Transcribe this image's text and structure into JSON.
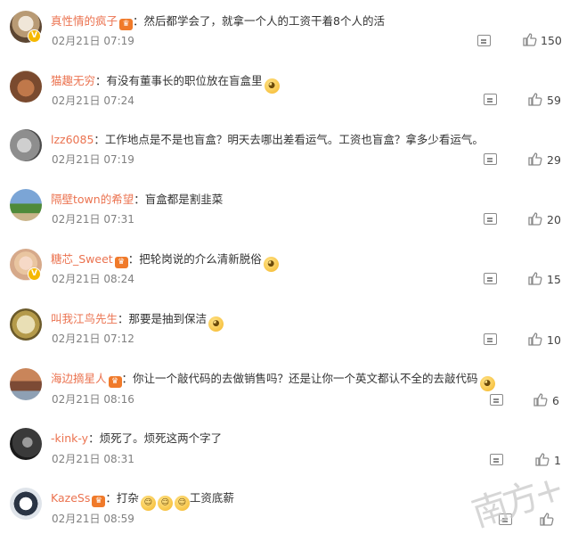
{
  "comments": [
    {
      "user": "真性情的疯子",
      "has_crown": true,
      "verified": true,
      "text": "：然后都学会了，就拿一个人的工资干着8个人的活",
      "emoji": [],
      "time": "02月21日 07:19",
      "likes": "150"
    },
    {
      "user": "猫趣无穷",
      "has_crown": false,
      "verified": false,
      "text": "：有没有董事长的职位放在盲盒里",
      "emoji": [
        "doge"
      ],
      "time": "02月21日 07:24",
      "likes": "59"
    },
    {
      "user": "lzz6085",
      "has_crown": false,
      "verified": false,
      "text": "：工作地点是不是也盲盒？明天去哪出差看运气。工资也盲盒？拿多少看运气。",
      "emoji": [],
      "time": "02月21日 07:19",
      "likes": "29"
    },
    {
      "user": "隔壁town的希望",
      "has_crown": false,
      "verified": false,
      "text": "：盲盒都是割韭菜",
      "emoji": [],
      "time": "02月21日 07:31",
      "likes": "20"
    },
    {
      "user": "糖芯_Sweet",
      "has_crown": true,
      "verified": true,
      "text": "：把轮岗说的介么清新脱俗",
      "emoji": [
        "doge"
      ],
      "time": "02月21日 08:24",
      "likes": "15"
    },
    {
      "user": "叫我江鸟先生",
      "has_crown": false,
      "verified": false,
      "text": "：那要是抽到保洁",
      "emoji": [
        "doge"
      ],
      "time": "02月21日 07:12",
      "likes": "10"
    },
    {
      "user": "海边摘星人",
      "has_crown": true,
      "verified": false,
      "text": "：你让一个敲代码的去做销售吗？还是让你一个英文都认不全的去敲代码",
      "emoji": [
        "doge"
      ],
      "time": "02月21日 08:16",
      "likes": "6"
    },
    {
      "user": "-kink-y",
      "has_crown": false,
      "verified": false,
      "text": "：烦死了。烦死这两个字了",
      "emoji": [],
      "time": "02月21日 08:31",
      "likes": "1"
    },
    {
      "user": "KazeSs",
      "has_crown": true,
      "verified": false,
      "text": "：打杂",
      "emoji": [
        "laugh",
        "laugh",
        "laugh"
      ],
      "after_emoji_text": "工资底薪",
      "time": "02月21日 08:59",
      "likes": ""
    }
  ],
  "watermark": "南方+",
  "icons": {
    "reply": "comment-icon",
    "like": "thumbs-up-icon",
    "verified": "verified-badge-icon",
    "crown": "member-crown-icon",
    "emoji": "doge-emoji-icon"
  }
}
